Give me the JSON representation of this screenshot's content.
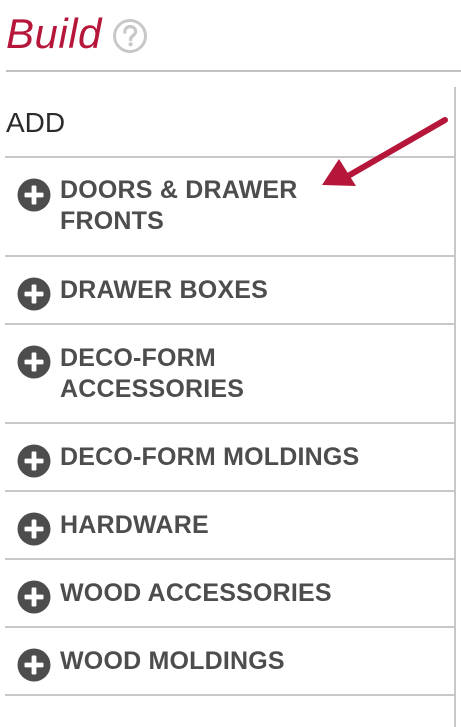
{
  "header": {
    "title": "Build",
    "help_icon": "question-circle-icon"
  },
  "panel": {
    "heading": "ADD",
    "items": [
      {
        "label": "DOORS & DRAWER FRONTS",
        "icon": "plus-circle-icon"
      },
      {
        "label": "DRAWER BOXES",
        "icon": "plus-circle-icon"
      },
      {
        "label": "DECO-FORM ACCESSORIES",
        "icon": "plus-circle-icon"
      },
      {
        "label": "DECO-FORM MOLDINGS",
        "icon": "plus-circle-icon"
      },
      {
        "label": "HARDWARE",
        "icon": "plus-circle-icon"
      },
      {
        "label": "WOOD ACCESSORIES",
        "icon": "plus-circle-icon"
      },
      {
        "label": "WOOD MOLDINGS",
        "icon": "plus-circle-icon"
      }
    ]
  },
  "annotation": {
    "icon": "arrow-icon",
    "color": "#b5163a"
  },
  "colors": {
    "brand": "#b5163a",
    "item_text": "#4d4d4d",
    "icon_fill": "#4d4d4d",
    "divider": "#c8c8c8"
  }
}
